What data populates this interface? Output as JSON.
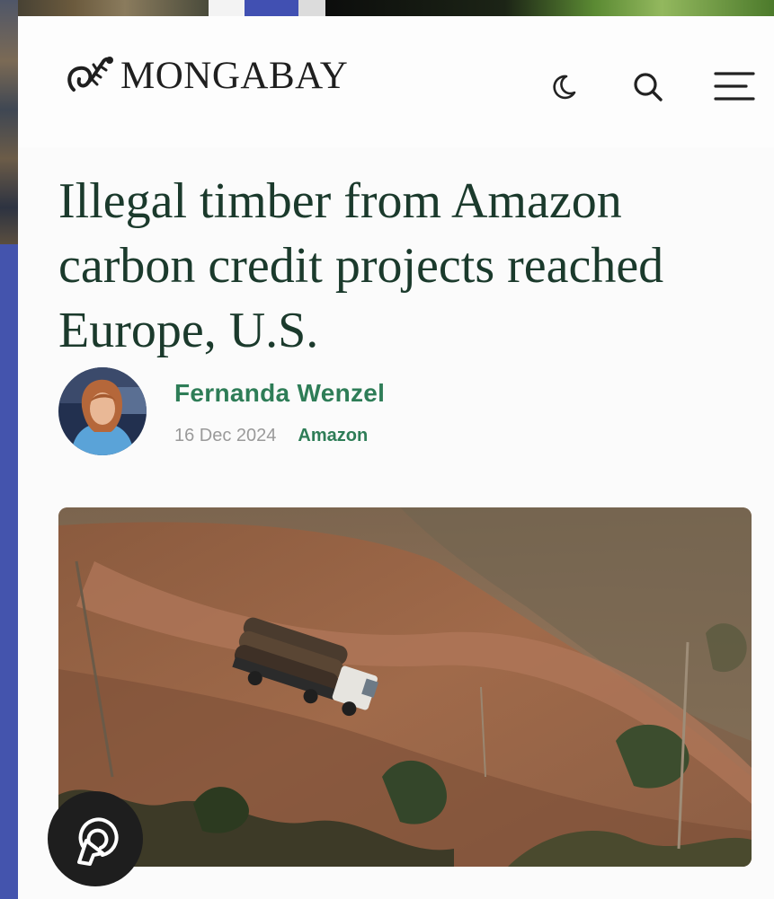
{
  "header": {
    "logo_text": "MONGABAY",
    "icons": [
      "gecko-logo-icon",
      "moon-icon",
      "search-icon",
      "menu-icon"
    ]
  },
  "article": {
    "title": "Illegal timber from Amazon carbon credit projects reached Europe, U.S.",
    "author": "Fernanda Wenzel",
    "date": "16 Dec 2024",
    "topic": "Amazon"
  },
  "overlay": {
    "fab_icon": "cursor-spark-icon"
  },
  "colors": {
    "title": "#1b3a2c",
    "accent_green": "#2e7d57",
    "muted": "#9a9a9a",
    "fab_bg": "#1e1e1e"
  }
}
